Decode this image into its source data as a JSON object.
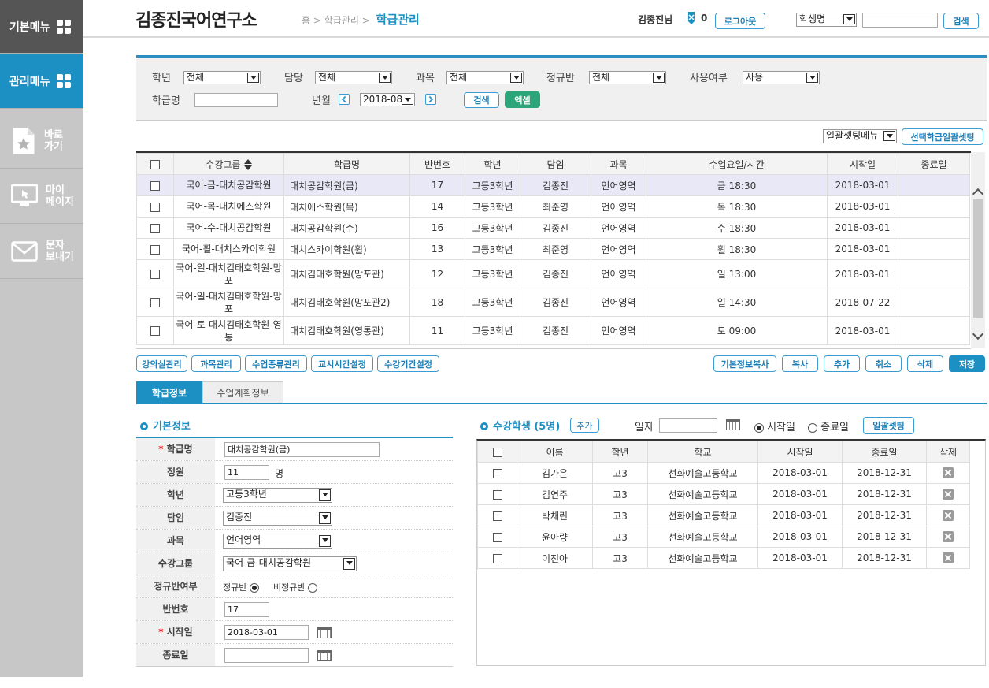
{
  "sidebar": {
    "basic": "기본메뉴",
    "manage": "관리메뉴",
    "shortcut": [
      "바로",
      "가기"
    ],
    "mypage": [
      "마이",
      "페이지"
    ],
    "sms": [
      "문자",
      "보내기"
    ]
  },
  "header": {
    "title": "김종진국어연구소",
    "crumb_home": "홈",
    "crumb_mid": "학급관리",
    "crumb_cur": "학급관리",
    "user": "김종진님",
    "note_count": "0",
    "logout": "로그아웃",
    "search_type": "학생명",
    "search_value": "",
    "search_btn": "검색"
  },
  "filter": {
    "grade_label": "학년",
    "grade": "전체",
    "teacher_label": "담당",
    "teacher": "전체",
    "subject_label": "과목",
    "subject": "전체",
    "regular_label": "정규반",
    "regular": "전체",
    "use_label": "사용여부",
    "use": "사용",
    "classname_label": "학급명",
    "classname": "",
    "ym_label": "년월",
    "ym": "2018-08",
    "search_btn": "검색",
    "excel_btn": "엑셀"
  },
  "bulk": {
    "menu": "일괄셋팅메뉴",
    "btn": "선택학급일괄셋팅"
  },
  "main_table": {
    "headers": [
      "수강그룹",
      "학급명",
      "반번호",
      "학년",
      "담임",
      "과목",
      "수업요일/시간",
      "시작일",
      "종료일"
    ],
    "rows": [
      {
        "group": "국어-금-대치공감학원",
        "name": "대치공감학원(금)",
        "no": "17",
        "grade": "고등3학년",
        "teacher": "김종진",
        "subject": "언어영역",
        "time": "금 18:30",
        "start": "2018-03-01",
        "end": ""
      },
      {
        "group": "국어-목-대치에스학원",
        "name": "대치에스학원(목)",
        "no": "14",
        "grade": "고등3학년",
        "teacher": "최준영",
        "subject": "언어영역",
        "time": "목 18:30",
        "start": "2018-03-01",
        "end": ""
      },
      {
        "group": "국어-수-대치공감학원",
        "name": "대치공감학원(수)",
        "no": "16",
        "grade": "고등3학년",
        "teacher": "김종진",
        "subject": "언어영역",
        "time": "수 18:30",
        "start": "2018-03-01",
        "end": ""
      },
      {
        "group": "국어-휠-대치스카이학원",
        "name": "대치스카이학원(휠)",
        "no": "13",
        "grade": "고등3학년",
        "teacher": "최준영",
        "subject": "언어영역",
        "time": "휠 18:30",
        "start": "2018-03-01",
        "end": ""
      },
      {
        "group": "국어-일-대치김태호학원-망포",
        "name": "대치김태호학원(망포관)",
        "no": "12",
        "grade": "고등3학년",
        "teacher": "김종진",
        "subject": "언어영역",
        "time": "일 13:00",
        "start": "2018-03-01",
        "end": ""
      },
      {
        "group": "국어-일-대치김태호학원-망포",
        "name": "대치김태호학원(망포관2)",
        "no": "18",
        "grade": "고등3학년",
        "teacher": "김종진",
        "subject": "언어영역",
        "time": "일 14:30",
        "start": "2018-07-22",
        "end": ""
      },
      {
        "group": "국어-토-대치김태호학원-영통",
        "name": "대치김태호학원(영통관)",
        "no": "11",
        "grade": "고등3학년",
        "teacher": "김종진",
        "subject": "언어영역",
        "time": "토 09:00",
        "start": "2018-03-01",
        "end": ""
      }
    ]
  },
  "left_buttons": [
    "강의실관리",
    "과목관리",
    "수업종류관리",
    "교시시간설정",
    "수강기간설정"
  ],
  "right_buttons": [
    "기본정보복사",
    "복사",
    "추가",
    "취소",
    "삭제",
    "저장"
  ],
  "tabs": [
    "학급정보",
    "수업계획정보"
  ],
  "basic_info": {
    "title": "기본정보",
    "name_label": "학급명",
    "name": "대치공감학원(금)",
    "cap_label": "정원",
    "cap": "11",
    "cap_unit": "명",
    "grade_label": "학년",
    "grade": "고등3학년",
    "teacher_label": "담임",
    "teacher": "김종진",
    "subject_label": "과목",
    "subject": "언어영역",
    "group_label": "수강그룹",
    "group": "국어-금-대치공감학원",
    "regular_label": "정규반여부",
    "regular_opt": "정규반",
    "irregular_opt": "비정규반",
    "no_label": "반번호",
    "no": "17",
    "start_label": "시작일",
    "start": "2018-03-01",
    "end_label": "종료일",
    "end": ""
  },
  "students": {
    "title": "수강학생 (5명)",
    "add_btn": "추가",
    "date_label": "일자",
    "date": "",
    "start_opt": "시작일",
    "end_opt": "종료일",
    "bulk_btn": "일괄셋팅",
    "headers": [
      "이름",
      "학년",
      "학교",
      "시작일",
      "종료일",
      "삭제"
    ],
    "rows": [
      {
        "name": "김가은",
        "grade": "고3",
        "school": "선화예술고등학교",
        "start": "2018-03-01",
        "end": "2018-12-31"
      },
      {
        "name": "김연주",
        "grade": "고3",
        "school": "선화예술고등학교",
        "start": "2018-03-01",
        "end": "2018-12-31"
      },
      {
        "name": "박채린",
        "grade": "고3",
        "school": "선화예술고등학교",
        "start": "2018-03-01",
        "end": "2018-12-31"
      },
      {
        "name": "윤아량",
        "grade": "고3",
        "school": "선화예술고등학교",
        "start": "2018-03-01",
        "end": "2018-12-31"
      },
      {
        "name": "이진아",
        "grade": "고3",
        "school": "선화예술고등학교",
        "start": "2018-03-01",
        "end": "2018-12-31"
      }
    ]
  }
}
